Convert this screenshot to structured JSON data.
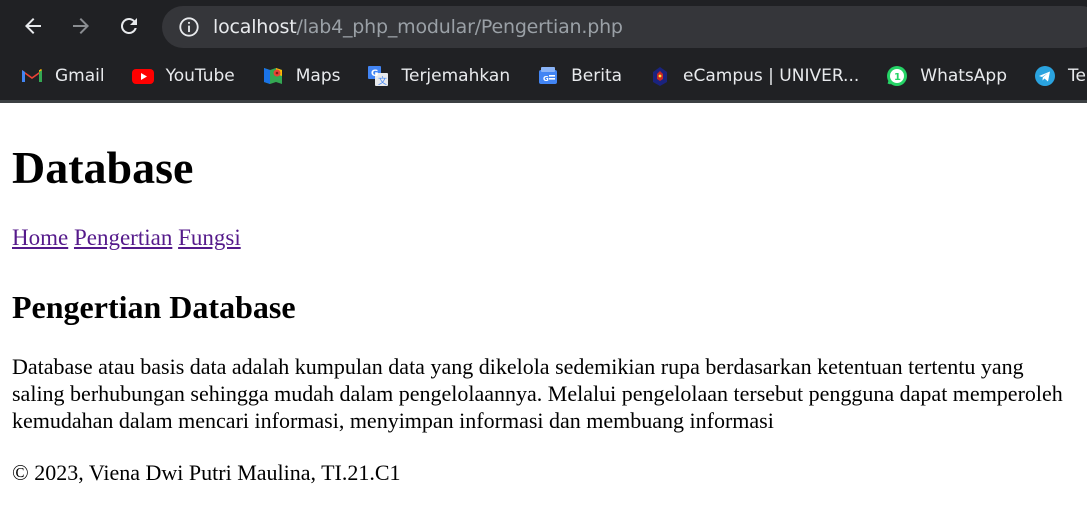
{
  "browser": {
    "url_host": "localhost",
    "url_path": "/lab4_php_modular/Pengertian.php",
    "bookmarks": [
      {
        "label": "Gmail",
        "icon": "gmail-icon"
      },
      {
        "label": "YouTube",
        "icon": "youtube-icon"
      },
      {
        "label": "Maps",
        "icon": "maps-icon"
      },
      {
        "label": "Terjemahkan",
        "icon": "translate-icon"
      },
      {
        "label": "Berita",
        "icon": "news-icon"
      },
      {
        "label": "eCampus | UNIVER...",
        "icon": "ecampus-icon"
      },
      {
        "label": "WhatsApp",
        "icon": "whatsapp-icon"
      },
      {
        "label": "Telegra",
        "icon": "telegram-icon"
      }
    ]
  },
  "page": {
    "title": "Database",
    "nav": [
      "Home",
      "Pengertian",
      "Fungsi"
    ],
    "heading": "Pengertian Database",
    "paragraph": "Database atau basis data adalah kumpulan data yang dikelola sedemikian rupa berdasarkan ketentuan tertentu yang saling berhubungan sehingga mudah dalam pengelolaannya. Melalui pengelolaan tersebut pengguna dapat memperoleh kemudahan dalam mencari informasi, menyimpan informasi dan membuang informasi",
    "footer": "© 2023, Viena Dwi Putri Maulina, TI.21.C1"
  },
  "colors": {
    "chrome_bg": "#202124",
    "omnibox_bg": "#35363a",
    "visited_link": "#551a8b"
  }
}
